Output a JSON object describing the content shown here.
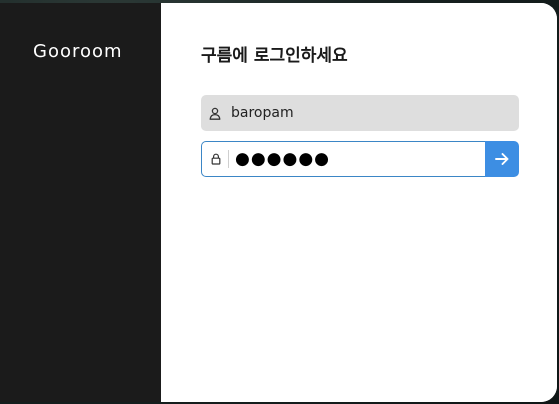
{
  "brand": {
    "name": "Gooroom"
  },
  "login": {
    "title": "구름에 로그인하세요",
    "username_value": "baropam",
    "password_masked": "●●●●●●"
  },
  "icons": {
    "username": "user-icon",
    "password": "lock-icon",
    "submit": "arrow-right-icon"
  },
  "colors": {
    "brand_panel": "#1b1b1b",
    "accent": "#3d8ee3",
    "input_border": "#3b86c6",
    "username_bg": "#dedede"
  }
}
